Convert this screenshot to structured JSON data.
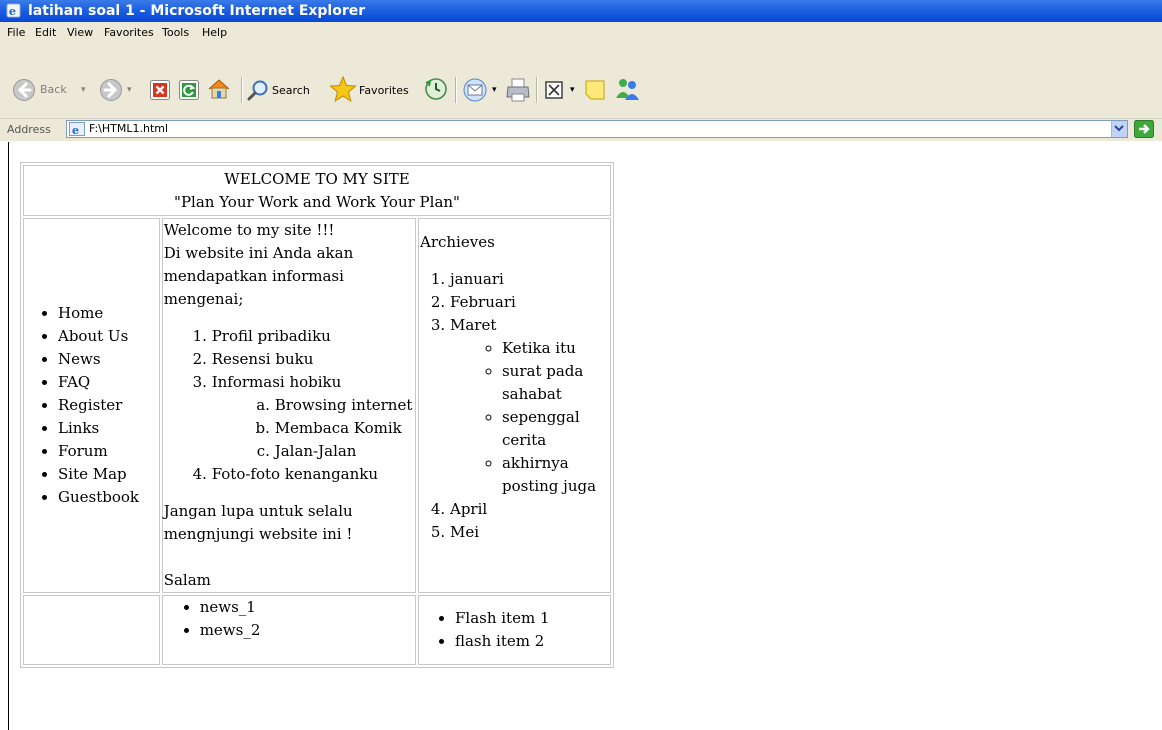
{
  "window": {
    "title": "latihan soal 1 - Microsoft Internet Explorer"
  },
  "menu": [
    "File",
    "Edit",
    "View",
    "Favorites",
    "Tools",
    "Help"
  ],
  "toolbar": {
    "back_label": "Back",
    "search_label": "Search",
    "favorites_label": "Favorites"
  },
  "address": {
    "label": "Address",
    "value": "F:\\HTML1.html"
  },
  "site": {
    "header": {
      "title": "WELCOME TO MY SITE",
      "tagline": "\"Plan Your Work and Work Your Plan\""
    },
    "nav": [
      "Home",
      "About Us",
      "News",
      "FAQ",
      "Register",
      "Links",
      "Forum",
      "Site Map",
      "Guestbook"
    ],
    "content": {
      "intro1": "Welcome to my site !!!",
      "intro2": "Di website ini Anda akan mendapatkan informasi mengenai;",
      "items": [
        "Profil pribadiku",
        "Resensi buku",
        "Informasi hobiku",
        "Foto-foto kenanganku"
      ],
      "hobbies": [
        "Browsing internet",
        "Membaca Komik",
        "Jalan-Jalan"
      ],
      "outro": "Jangan lupa untuk selalu mengnjungi website ini !",
      "closing": "Salam"
    },
    "archives": {
      "title": "Archieves",
      "months": [
        "januari",
        "Februari",
        "Maret",
        "April",
        "Mei"
      ],
      "maret_posts": [
        "Ketika itu",
        "surat pada sahabat",
        "sepenggal cerita",
        "akhirnya posting juga"
      ]
    },
    "news": [
      "news_1",
      "mews_2"
    ],
    "flash": [
      "Flash item 1",
      "flash item 2"
    ]
  }
}
